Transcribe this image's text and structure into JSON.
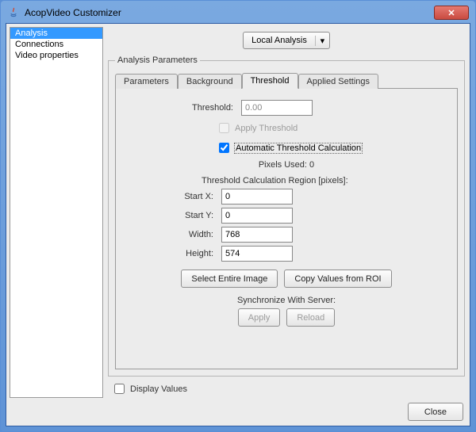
{
  "window": {
    "title": "AcopVideo Customizer",
    "close_glyph": "✕"
  },
  "sidebar": {
    "items": [
      {
        "label": "Analysis",
        "selected": true
      },
      {
        "label": "Connections",
        "selected": false
      },
      {
        "label": "Video properties",
        "selected": false
      }
    ]
  },
  "mode_dropdown": {
    "label": "Local Analysis",
    "arrow": "▾"
  },
  "params_group": {
    "legend": "Analysis Parameters"
  },
  "tabs": [
    {
      "label": "Parameters",
      "active": false
    },
    {
      "label": "Background",
      "active": false
    },
    {
      "label": "Threshold",
      "active": true
    },
    {
      "label": "Applied Settings",
      "active": false
    }
  ],
  "threshold_panel": {
    "threshold_label": "Threshold:",
    "threshold_value": "0.00",
    "apply_threshold_label": "Apply Threshold",
    "apply_threshold_checked": false,
    "auto_calc_label": "Automatic Threshold Calculation",
    "auto_calc_checked": true,
    "pixels_used_label": "Pixels Used: 0",
    "region_title": "Threshold Calculation Region [pixels]:",
    "start_x_label": "Start X:",
    "start_x_value": "0",
    "start_y_label": "Start Y:",
    "start_y_value": "0",
    "width_label": "Width:",
    "width_value": "768",
    "height_label": "Height:",
    "height_value": "574",
    "select_entire_label": "Select Entire Image",
    "copy_roi_label": "Copy Values from ROI",
    "sync_title": "Synchronize With Server:",
    "apply_label": "Apply",
    "reload_label": "Reload"
  },
  "display_values_label": "Display Values",
  "footer": {
    "close_label": "Close"
  }
}
